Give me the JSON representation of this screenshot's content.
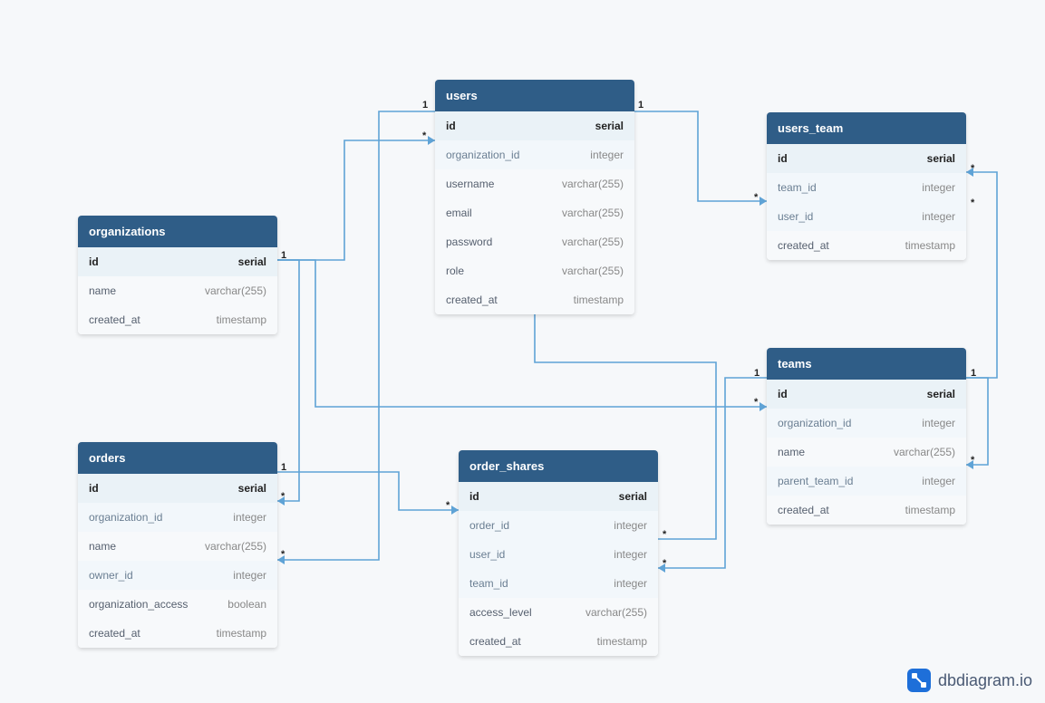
{
  "tables": {
    "users": {
      "title": "users",
      "cols": [
        {
          "name": "id",
          "type": "serial",
          "kind": "pk"
        },
        {
          "name": "organization_id",
          "type": "integer",
          "kind": "fk"
        },
        {
          "name": "username",
          "type": "varchar(255)",
          "kind": "normal"
        },
        {
          "name": "email",
          "type": "varchar(255)",
          "kind": "normal"
        },
        {
          "name": "password",
          "type": "varchar(255)",
          "kind": "normal"
        },
        {
          "name": "role",
          "type": "varchar(255)",
          "kind": "normal"
        },
        {
          "name": "created_at",
          "type": "timestamp",
          "kind": "normal"
        }
      ]
    },
    "users_team": {
      "title": "users_team",
      "cols": [
        {
          "name": "id",
          "type": "serial",
          "kind": "pk"
        },
        {
          "name": "team_id",
          "type": "integer",
          "kind": "fk"
        },
        {
          "name": "user_id",
          "type": "integer",
          "kind": "fk"
        },
        {
          "name": "created_at",
          "type": "timestamp",
          "kind": "normal"
        }
      ]
    },
    "organizations": {
      "title": "organizations",
      "cols": [
        {
          "name": "id",
          "type": "serial",
          "kind": "pk"
        },
        {
          "name": "name",
          "type": "varchar(255)",
          "kind": "normal"
        },
        {
          "name": "created_at",
          "type": "timestamp",
          "kind": "normal"
        }
      ]
    },
    "teams": {
      "title": "teams",
      "cols": [
        {
          "name": "id",
          "type": "serial",
          "kind": "pk"
        },
        {
          "name": "organization_id",
          "type": "integer",
          "kind": "fk"
        },
        {
          "name": "name",
          "type": "varchar(255)",
          "kind": "normal"
        },
        {
          "name": "parent_team_id",
          "type": "integer",
          "kind": "fk"
        },
        {
          "name": "created_at",
          "type": "timestamp",
          "kind": "normal"
        }
      ]
    },
    "orders": {
      "title": "orders",
      "cols": [
        {
          "name": "id",
          "type": "serial",
          "kind": "pk"
        },
        {
          "name": "organization_id",
          "type": "integer",
          "kind": "fk"
        },
        {
          "name": "name",
          "type": "varchar(255)",
          "kind": "normal"
        },
        {
          "name": "owner_id",
          "type": "integer",
          "kind": "fk"
        },
        {
          "name": "organization_access",
          "type": "boolean",
          "kind": "normal"
        },
        {
          "name": "created_at",
          "type": "timestamp",
          "kind": "normal"
        }
      ]
    },
    "order_shares": {
      "title": "order_shares",
      "cols": [
        {
          "name": "id",
          "type": "serial",
          "kind": "pk"
        },
        {
          "name": "order_id",
          "type": "integer",
          "kind": "fk"
        },
        {
          "name": "user_id",
          "type": "integer",
          "kind": "fk"
        },
        {
          "name": "team_id",
          "type": "integer",
          "kind": "fk"
        },
        {
          "name": "access_level",
          "type": "varchar(255)",
          "kind": "normal"
        },
        {
          "name": "created_at",
          "type": "timestamp",
          "kind": "normal"
        }
      ]
    }
  },
  "cardinality": {
    "one": "1",
    "many": "*"
  },
  "logo_text": "dbdiagram.io",
  "relationships": [
    {
      "from": "users.organization_id",
      "to": "organizations.id",
      "card": [
        "*",
        "1"
      ]
    },
    {
      "from": "users_team.user_id",
      "to": "users.id",
      "card": [
        "*",
        "1"
      ]
    },
    {
      "from": "users_team.team_id",
      "to": "teams.id",
      "card": [
        "*",
        "1"
      ]
    },
    {
      "from": "teams.organization_id",
      "to": "organizations.id",
      "card": [
        "*",
        "1"
      ]
    },
    {
      "from": "teams.parent_team_id",
      "to": "teams.id",
      "card": [
        "*",
        "1"
      ]
    },
    {
      "from": "orders.organization_id",
      "to": "organizations.id",
      "card": [
        "*",
        "1"
      ]
    },
    {
      "from": "orders.owner_id",
      "to": "users.id",
      "card": [
        "*",
        "1"
      ]
    },
    {
      "from": "order_shares.order_id",
      "to": "orders.id",
      "card": [
        "*",
        "1"
      ]
    },
    {
      "from": "order_shares.user_id",
      "to": "users.id",
      "card": [
        "*",
        "1"
      ]
    },
    {
      "from": "order_shares.team_id",
      "to": "teams.id",
      "card": [
        "*",
        "1"
      ]
    }
  ]
}
